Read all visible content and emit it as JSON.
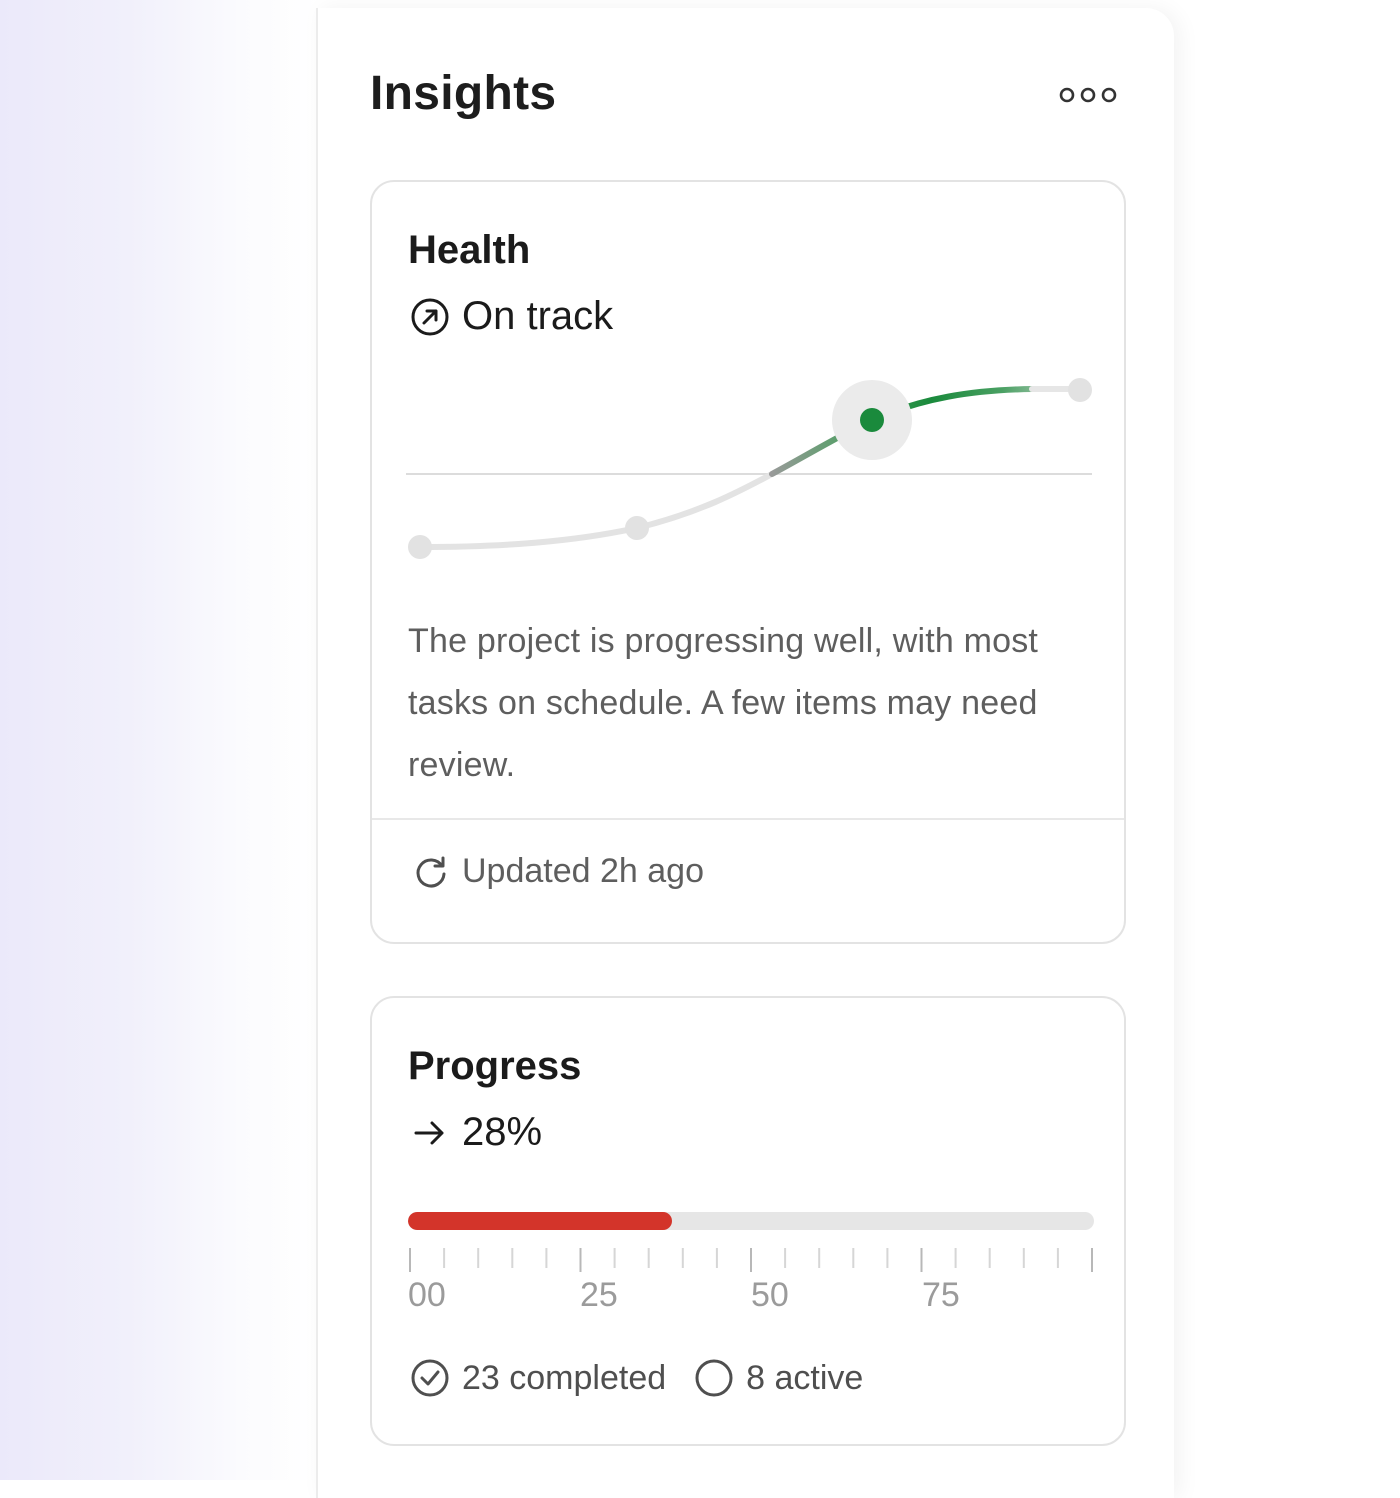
{
  "panel": {
    "title": "Insights",
    "menu_icon": "more-horizontal-icon"
  },
  "health": {
    "title": "Health",
    "status": "On track",
    "status_icon": "arrow-up-right-circle-icon",
    "description": "The project is progressing well, with most tasks on schedule. A few items may need review.",
    "updated": "Updated 2h ago",
    "updated_icon": "refresh-icon",
    "accent_color": "#1a8a3c"
  },
  "progress": {
    "title": "Progress",
    "status_icon": "arrow-right-icon",
    "value_label": "28%",
    "fill_fraction": 0.385,
    "fill_color": "#d3342a",
    "tick_labels": [
      "00",
      "25",
      "50",
      "75"
    ],
    "completed_label": "23 completed",
    "completed_icon": "check-circle-icon",
    "active_label": "8 active",
    "active_icon": "circle-icon"
  }
}
